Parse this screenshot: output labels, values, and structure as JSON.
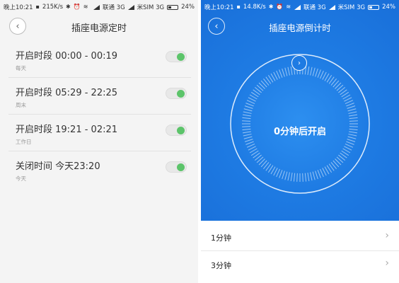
{
  "left": {
    "status": {
      "time": "晚上10:21",
      "speed": "215K/s",
      "carrier1": "联通 3G",
      "carrier2": "米SIM 3G",
      "battery": "24%"
    },
    "title": "插座电源定时",
    "rows": [
      {
        "label": "开启时段 00:00 - 00:19",
        "sub": "每天",
        "on": true
      },
      {
        "label": "开启时段 05:29 - 22:25",
        "sub": "周末",
        "on": true
      },
      {
        "label": "开启时段 19:21 - 02:21",
        "sub": "工作日",
        "on": true
      },
      {
        "label": "关闭时间  今天23:20",
        "sub": "今天",
        "on": true
      }
    ]
  },
  "right": {
    "status": {
      "time": "晚上10:21",
      "speed": "14.8K/s",
      "carrier1": "联通 3G",
      "carrier2": "米SIM 3G",
      "battery": "24%"
    },
    "title": "插座电源倒计时",
    "dial_text": "0分钟后开启",
    "options": [
      {
        "label": "1分钟"
      },
      {
        "label": "3分钟"
      }
    ]
  },
  "colors": {
    "toggle_on": "#5cc46a",
    "blue_bg": "#1e7be3"
  },
  "icons": [
    "back-arrow-icon",
    "chevron-right-icon",
    "bluetooth-icon",
    "alarm-icon",
    "wifi-icon",
    "signal-icon",
    "battery-icon"
  ]
}
